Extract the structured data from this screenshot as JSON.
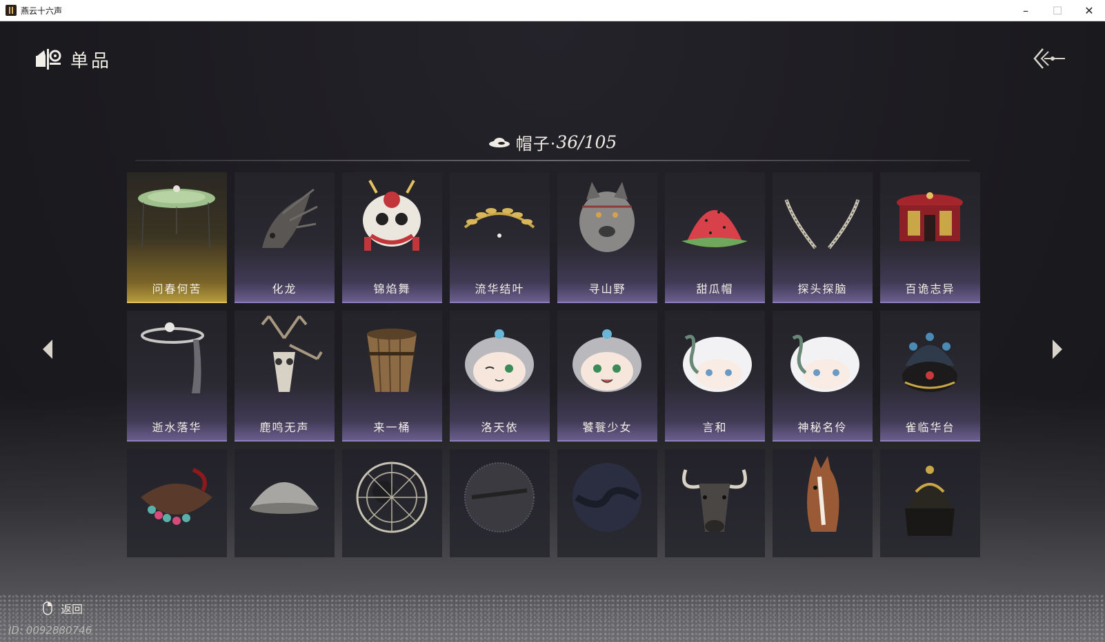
{
  "window": {
    "title": "燕云十六声",
    "min_glyph": "–",
    "max_glyph": "☐",
    "close_glyph": "✕"
  },
  "header": {
    "title": "单品",
    "icon": "hat-category-icon",
    "back_icon": "back-arrow-icon"
  },
  "category": {
    "label": "帽子·",
    "owned": 36,
    "total": 105,
    "count_text": "36/105",
    "icon": "hat-icon"
  },
  "rows": [
    {
      "items": [
        {
          "name": "问春何苦",
          "art": "bamboo-hat",
          "selected": true
        },
        {
          "name": "化龙",
          "art": "dragon-head"
        },
        {
          "name": "锦焰舞",
          "art": "lion-dance-head"
        },
        {
          "name": "流华结叶",
          "art": "golden-laurel"
        },
        {
          "name": "寻山野",
          "art": "wolf-head"
        },
        {
          "name": "甜瓜帽",
          "art": "watermelon-hat"
        },
        {
          "name": "探头探脑",
          "art": "pheasant-feathers"
        },
        {
          "name": "百诡志异",
          "art": "red-palanquin-hat"
        }
      ]
    },
    {
      "items": [
        {
          "name": "逝水落华",
          "art": "veiled-crown"
        },
        {
          "name": "鹿鸣无声",
          "art": "deer-skull"
        },
        {
          "name": "来一桶",
          "art": "wooden-bucket"
        },
        {
          "name": "洛天依",
          "art": "luo-tianyi-head-wink"
        },
        {
          "name": "饕餮少女",
          "art": "luo-tianyi-head"
        },
        {
          "name": "言和",
          "art": "yanhe-head"
        },
        {
          "name": "神秘名伶",
          "art": "yanhe-head-2"
        },
        {
          "name": "雀临华台",
          "art": "phoenix-crown"
        }
      ]
    },
    {
      "items": [
        {
          "name": "",
          "art": "beaded-headpiece"
        },
        {
          "name": "",
          "art": "iron-bowl-hat"
        },
        {
          "name": "",
          "art": "rattan-hat"
        },
        {
          "name": "",
          "art": "woven-veil-hat"
        },
        {
          "name": "",
          "art": "dark-cloth-hat"
        },
        {
          "name": "",
          "art": "buffalo-head"
        },
        {
          "name": "",
          "art": "horse-head"
        },
        {
          "name": "",
          "art": "golden-helmet"
        }
      ]
    }
  ],
  "footer": {
    "back_label": "返回",
    "mouse_icon": "mouse-icon",
    "player_id": "ID: 0092880746"
  },
  "colors": {
    "selected_border": "#e6c65a",
    "card_border": "#8e7fc0",
    "background": "#1b1b1f"
  }
}
